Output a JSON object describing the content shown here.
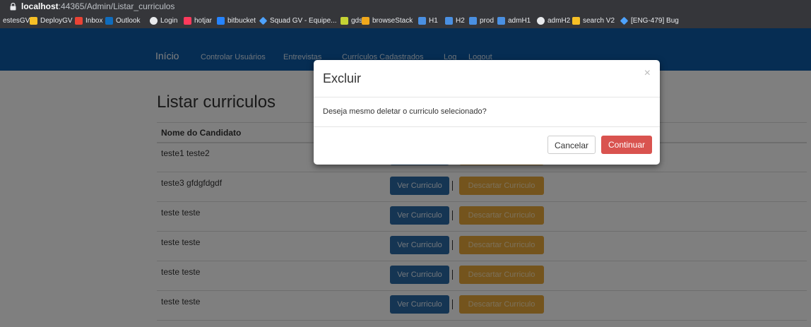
{
  "browser": {
    "url_host": "localhost",
    "url_rest": ":44365/Admin/Listar_curriculos",
    "bookmarks": [
      {
        "label": "estesGV",
        "icon": "folder-icon",
        "color": "#35363a"
      },
      {
        "label": "DeployGV",
        "icon": "folder-icon",
        "color": "#f6c026"
      },
      {
        "label": "Inbox",
        "icon": "gmail-icon",
        "color": "#ea4335"
      },
      {
        "label": "Outlook",
        "icon": "outlook-icon",
        "color": "#0f6cbd"
      },
      {
        "label": "Login",
        "icon": "globe-icon",
        "color": "#e8eaed"
      },
      {
        "label": "hotjar",
        "icon": "hotjar-icon",
        "color": "#fd3a5c"
      },
      {
        "label": "bitbucket",
        "icon": "bitbucket-icon",
        "color": "#2684ff"
      },
      {
        "label": "Squad GV - Equipe...",
        "icon": "diamond-icon",
        "color": "#4ea3ff"
      },
      {
        "label": "gds",
        "icon": "leaf-icon",
        "color": "#c5d334"
      },
      {
        "label": "browseStack",
        "icon": "browserstack-icon",
        "color": "#f0a81c"
      },
      {
        "label": "H1",
        "icon": "flag-icon",
        "color": "#4a90e2"
      },
      {
        "label": "H2",
        "icon": "flag-icon",
        "color": "#4a90e2"
      },
      {
        "label": "prod",
        "icon": "flag-icon",
        "color": "#4a90e2"
      },
      {
        "label": "admH1",
        "icon": "flag-icon",
        "color": "#4a90e2"
      },
      {
        "label": "admH2",
        "icon": "globe-icon",
        "color": "#e8eaed"
      },
      {
        "label": "search V2",
        "icon": "folder-icon",
        "color": "#f6c026"
      },
      {
        "label": "[ENG-479] Bug",
        "icon": "diamond-icon",
        "color": "#4ea3ff"
      }
    ]
  },
  "nav": {
    "brand": "Início",
    "items": [
      "Controlar Usuários",
      "Entrevistas",
      "Currículos Cadastrados",
      "Log",
      "Logout"
    ]
  },
  "page": {
    "title": "Listar curriculos",
    "column_name": "Nome do Candidato",
    "view_label": "Ver Curriculo",
    "discard_label": "Descartar Curriculo",
    "rows": [
      "teste1 teste2",
      "teste3 gfdgfdgdf",
      "teste teste",
      "teste teste",
      "teste teste",
      "teste teste"
    ]
  },
  "modal": {
    "title": "Excluir",
    "close": "×",
    "message": "Deseja mesmo deletar o curriculo selecionado?",
    "cancel_label": "Cancelar",
    "continue_label": "Continuar"
  },
  "colors": {
    "navbar": "#0d5ba6",
    "primary_button": "#2a6aa6",
    "warning_button": "#e9a93a",
    "danger_button": "#d9534f"
  }
}
